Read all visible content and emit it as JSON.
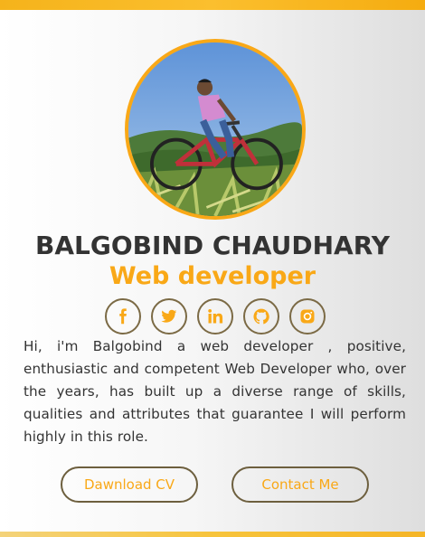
{
  "profile": {
    "name": "BALGOBIND CHAUDHARY",
    "role": "Web developer",
    "bio": "Hi, i'm Balgobind a web developer , positive, enthusiastic and competent Web Developer who, over the years, has built up a diverse range of skills, qualities and attributes that guarantee I will perform highly in this role."
  },
  "socials": [
    {
      "icon": "facebook-icon"
    },
    {
      "icon": "twitter-icon"
    },
    {
      "icon": "linkedin-icon"
    },
    {
      "icon": "github-icon"
    },
    {
      "icon": "instagram-icon"
    }
  ],
  "buttons": {
    "download_label": "Dawnload CV",
    "contact_label": "Contact Me"
  },
  "colors": {
    "accent": "#f9a817",
    "text": "#333333",
    "border": "#7b6a45"
  }
}
